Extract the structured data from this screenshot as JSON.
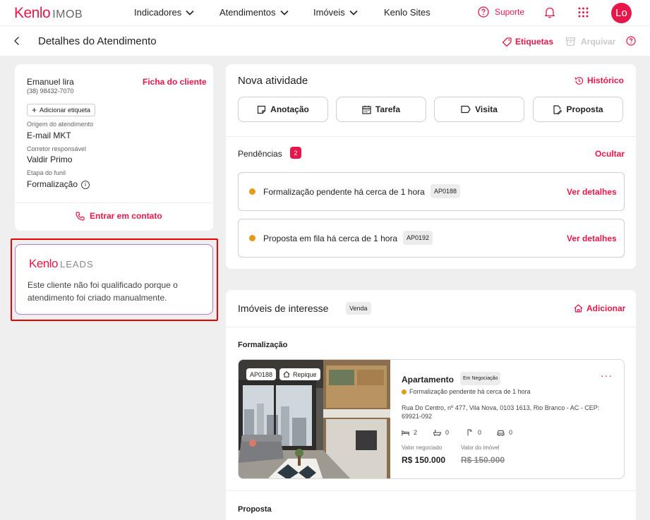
{
  "topbar": {
    "logo_brand": "Kenlo",
    "logo_product": "IMOB",
    "nav": [
      {
        "label": "Indicadores"
      },
      {
        "label": "Atendimentos"
      },
      {
        "label": "Imóveis"
      },
      {
        "label": "Kenlo Sites"
      }
    ],
    "support_label": "Suporte",
    "avatar_initials": "Lo"
  },
  "subheader": {
    "title": "Detalhes do Atendimento",
    "tags_label": "Etiquetas",
    "archive_label": "Arquivar"
  },
  "client": {
    "name": "Emanuel lira",
    "phone": "(38) 98432-7070",
    "sheet_link": "Ficha do cliente",
    "add_tag": "Adicionar etiqueta",
    "origin_label": "Origem do atendimento",
    "origin_value": "E-mail MKT",
    "broker_label": "Corretor responsável",
    "broker_value": "Valdir Primo",
    "stage_label": "Etapa do funil",
    "stage_value": "Formalização",
    "contact_label": "Entrar em contato"
  },
  "leads": {
    "brand": "Kenlo",
    "product": "LEADS",
    "message": "Este cliente não foi qualificado porque o atendimento foi criado manualmente."
  },
  "activity": {
    "title": "Nova atividade",
    "history_label": "Histórico",
    "buttons": [
      {
        "label": "Anotação",
        "icon": "note-icon"
      },
      {
        "label": "Tarefa",
        "icon": "calendar-icon"
      },
      {
        "label": "Visita",
        "icon": "tag-icon"
      },
      {
        "label": "Proposta",
        "icon": "document-edit-icon"
      }
    ],
    "pendencies_label": "Pendências",
    "pendencies_count": "2",
    "hide_label": "Ocultar",
    "pendencies": [
      {
        "text": "Formalização pendente há cerca de 1 hora",
        "code": "AP0188",
        "action": "Ver detalhes"
      },
      {
        "text": "Proposta em fila há cerca de 1 hora",
        "code": "AP0192",
        "action": "Ver detalhes"
      }
    ]
  },
  "properties": {
    "title": "Imóveis de interesse",
    "badge": "Venda",
    "add_label": "Adicionar",
    "section_formalization": "Formalização",
    "section_proposal": "Proposta",
    "item": {
      "code": "AP0188",
      "tag": "Repique",
      "type": "Apartamento",
      "status_badge": "Em Negociação",
      "status_text": "Formalização pendente há cerca de 1 hora",
      "address": "Rua Do Centro, nº 477, Vila Nova, 0103 1613, Rio Branco - AC - CEP: 69921-092",
      "features": {
        "bedrooms": "2",
        "bathrooms": "0",
        "suites": "0",
        "parking": "0"
      },
      "negotiated_label": "Valor negociado",
      "negotiated_value": "R$ 150.000",
      "property_value_label": "Valor do imóvel",
      "property_value": "R$ 150.000"
    }
  },
  "colors": {
    "accent": "#e8174a",
    "warning": "#e39b1a",
    "leads_border": "#b478c6",
    "highlight": "#e00000"
  }
}
